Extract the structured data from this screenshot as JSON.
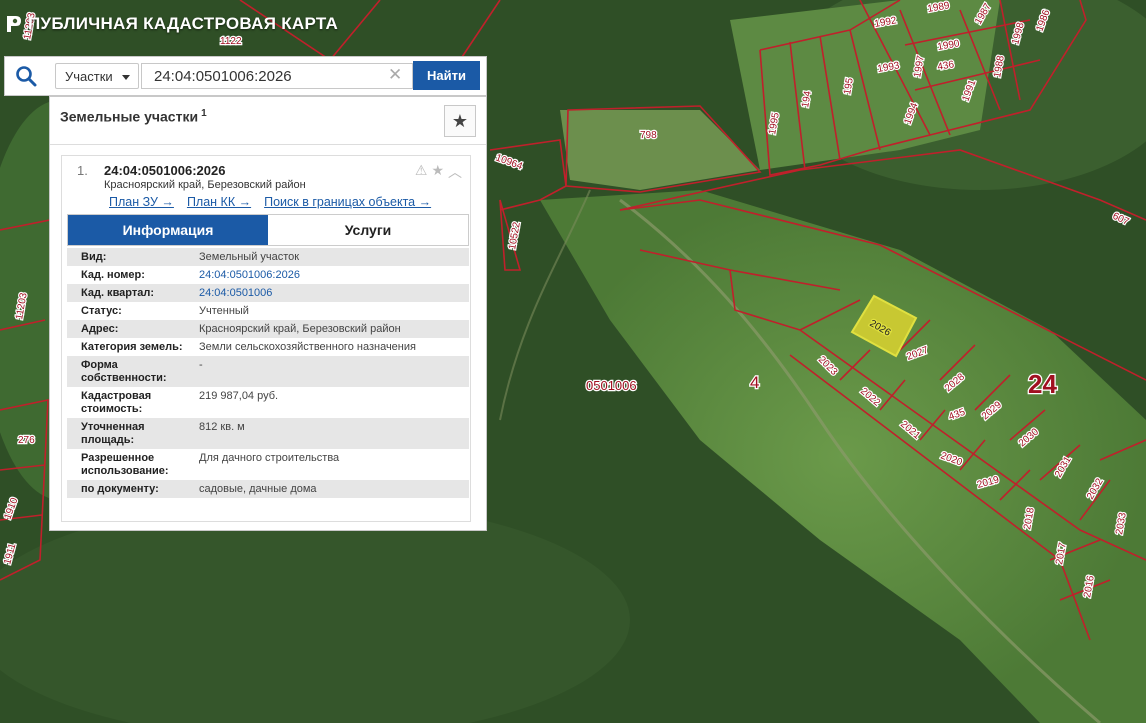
{
  "app": {
    "title": "ПУБЛИЧНАЯ КАДАСТРОВАЯ КАРТА"
  },
  "search": {
    "type_label": "Участки",
    "query": "24:04:0501006:2026",
    "find_label": "Найти"
  },
  "panel": {
    "title": "Земельные участки",
    "count": "1"
  },
  "result": {
    "index": "1.",
    "number": "24:04:0501006:2026",
    "region": "Красноярский край, Березовский район",
    "links": [
      "План ЗУ →",
      "План КК →",
      "Поиск в границах объекта →"
    ],
    "tabs": [
      "Информация",
      "Услуги"
    ],
    "rows": [
      {
        "k": "Вид:",
        "v": "Земельный участок"
      },
      {
        "k": "Кад. номер:",
        "v": "24:04:0501006:2026",
        "link": true
      },
      {
        "k": "Кад. квартал:",
        "v": "24:04:0501006",
        "link": true
      },
      {
        "k": "Статус:",
        "v": "Учтенный"
      },
      {
        "k": "Адрес:",
        "v": "Красноярский край, Березовский район"
      },
      {
        "k": "Категория земель:",
        "v": "Земли сельскохозяйственного назначения"
      },
      {
        "k": "Форма собственности:",
        "v": "-"
      },
      {
        "k": "Кадастровая стоимость:",
        "v": "219 987,04 руб."
      },
      {
        "k": "Уточненная площадь:",
        "v": "812 кв. м"
      },
      {
        "k": "Разрешенное использование:",
        "v": "Для дачного строительства"
      },
      {
        "k": "по документу:",
        "v": "садовые, дачные дома"
      }
    ]
  },
  "map_labels": {
    "quarter": "0501006",
    "district": "4",
    "region_num": "24",
    "parcels": [
      "1989",
      "1987",
      "1986",
      "1992",
      "1990",
      "1998",
      "1993",
      "1997",
      "436",
      "1988",
      "1991",
      "194",
      "195",
      "1994",
      "1995",
      "798",
      "10964",
      "10522",
      "607",
      "2026",
      "2027",
      "2023",
      "2028",
      "2022",
      "435",
      "2029",
      "2021",
      "2030",
      "2020",
      "2031",
      "2019",
      "2032",
      "2018",
      "2033",
      "2017",
      "2016",
      "1122",
      "1903",
      "11203",
      "276",
      "1910",
      "1911"
    ]
  },
  "colors": {
    "accent": "#1b5aa6",
    "boundary": "#c0202b",
    "selected_fill": "#c8c832"
  }
}
